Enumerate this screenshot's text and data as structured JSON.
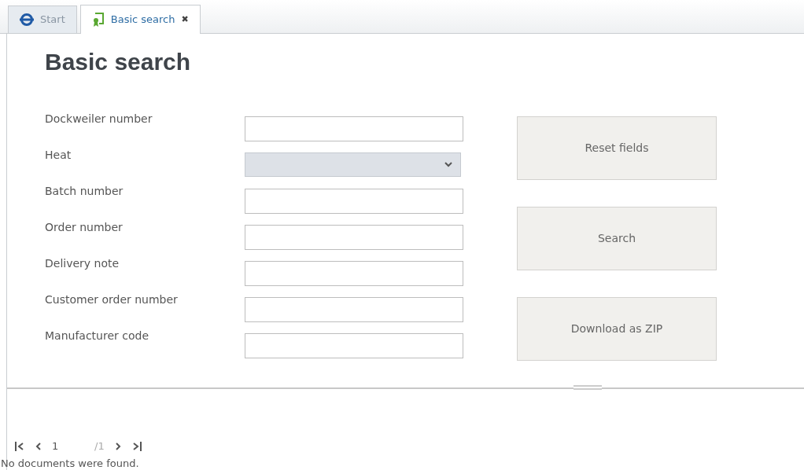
{
  "tabs": [
    {
      "label": "Start",
      "selected": false
    },
    {
      "label": "Basic search",
      "selected": true,
      "close": "✖"
    }
  ],
  "title": "Basic search",
  "fields": [
    {
      "label": "Dockweiler number",
      "kind": "text"
    },
    {
      "label": "Heat",
      "kind": "select"
    },
    {
      "label": "Batch number",
      "kind": "text"
    },
    {
      "label": "Order number",
      "kind": "text"
    },
    {
      "label": "Delivery note",
      "kind": "text"
    },
    {
      "label": "Customer order number",
      "kind": "text"
    },
    {
      "label": "Manufacturer code",
      "kind": "text"
    }
  ],
  "buttons": [
    "Reset fields",
    "Search",
    "Download as ZIP"
  ],
  "pager": {
    "page": "1",
    "total": "/1"
  },
  "message": "No documents were found."
}
